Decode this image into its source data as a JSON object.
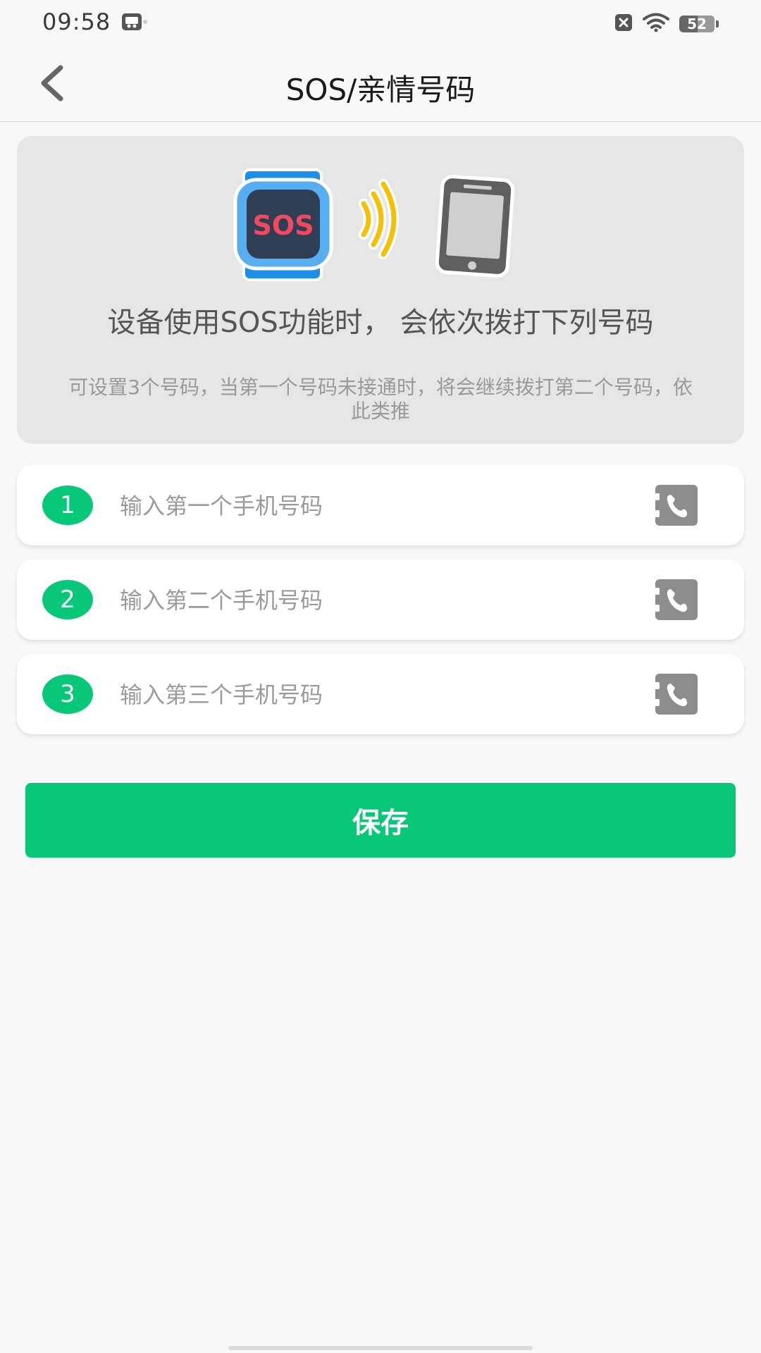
{
  "status_bar": {
    "time": "09:58",
    "battery_level": "52",
    "icons": [
      "app-notification-icon",
      "close-box-icon",
      "wifi-icon",
      "battery-icon"
    ]
  },
  "nav": {
    "title": "SOS/亲情号码",
    "back_icon": "chevron-left-icon"
  },
  "info": {
    "title": "设备使用SOS功能时， 会依次拨打下列号码",
    "description": "可设置3个号码，当第一个号码未接通时，将会继续拨打第二个号码，依此类推",
    "illustration": {
      "watch_label": "SOS",
      "icons": [
        "sos-watch-icon",
        "signal-waves-icon",
        "smartphone-icon"
      ]
    }
  },
  "phone_numbers": [
    {
      "index": "1",
      "value": "",
      "placeholder": "输入第一个手机号码",
      "icon": "contact-phone-icon"
    },
    {
      "index": "2",
      "value": "",
      "placeholder": "输入第二个手机号码",
      "icon": "contact-phone-icon"
    },
    {
      "index": "3",
      "value": "",
      "placeholder": "输入第三个手机号码",
      "icon": "contact-phone-icon"
    }
  ],
  "actions": {
    "save_label": "保存"
  },
  "colors": {
    "accent": "#07c878",
    "card_bg": "#e6e6e6",
    "page_bg": "#f8f8f8",
    "watch_blue": "#1e8fe8",
    "sos_red": "#f2495f",
    "wave_yellow": "#f5c000",
    "phone_gray": "#5f5f5f"
  }
}
